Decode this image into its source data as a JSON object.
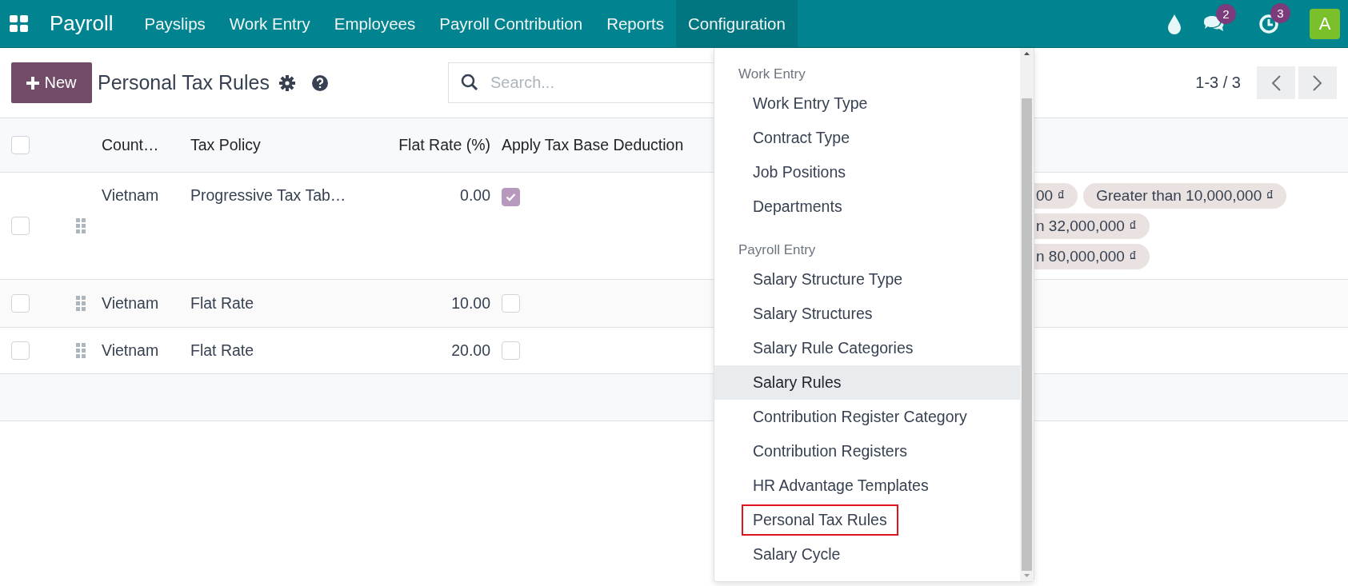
{
  "navbar": {
    "app": "Payroll",
    "menu": [
      {
        "label": "Payslips",
        "selected": false
      },
      {
        "label": "Work Entry",
        "selected": false
      },
      {
        "label": "Employees",
        "selected": false
      },
      {
        "label": "Payroll Contribution",
        "selected": false
      },
      {
        "label": "Reports",
        "selected": false
      },
      {
        "label": "Configuration",
        "selected": true
      }
    ],
    "chat_badge": "2",
    "activity_badge": "3",
    "avatar": "A"
  },
  "control_panel": {
    "new_button": "New",
    "title": "Personal Tax Rules",
    "search": {
      "placeholder": "Search..."
    },
    "pager": "1-3 / 3"
  },
  "table": {
    "columns": [
      "Count…",
      "Tax Policy",
      "Flat Rate (%)",
      "Apply Tax Base Deduction"
    ],
    "header_checked": false,
    "rows": [
      {
        "checked": false,
        "country": "Vietnam",
        "tax_policy": "Progressive Tax Tab…",
        "flat_rate": "0.00",
        "apply_deduction": true,
        "tags": [
          [
            "00 ₫",
            "Greater than 10,000,000 ₫"
          ],
          [
            "n 32,000,000 ₫"
          ],
          [
            "n 80,000,000 ₫"
          ]
        ]
      },
      {
        "checked": false,
        "country": "Vietnam",
        "tax_policy": "Flat Rate",
        "flat_rate": "10.00",
        "apply_deduction": false
      },
      {
        "checked": false,
        "country": "Vietnam",
        "tax_policy": "Flat Rate",
        "flat_rate": "20.00",
        "apply_deduction": false
      }
    ]
  },
  "dropdown": {
    "sections": [
      {
        "title": "Work Entry",
        "items": [
          {
            "label": "Work Entry Type",
            "highlighted": false,
            "outlined": false
          },
          {
            "label": "Contract Type",
            "highlighted": false,
            "outlined": false
          },
          {
            "label": "Job Positions",
            "highlighted": false,
            "outlined": false
          },
          {
            "label": "Departments",
            "highlighted": false,
            "outlined": false
          }
        ]
      },
      {
        "title": "Payroll Entry",
        "items": [
          {
            "label": "Salary Structure Type",
            "highlighted": false,
            "outlined": false
          },
          {
            "label": "Salary Structures",
            "highlighted": false,
            "outlined": false
          },
          {
            "label": "Salary Rule Categories",
            "highlighted": false,
            "outlined": false
          },
          {
            "label": "Salary Rules",
            "highlighted": true,
            "outlined": false
          },
          {
            "label": "Contribution Register Category",
            "highlighted": false,
            "outlined": false
          },
          {
            "label": "Contribution Registers",
            "highlighted": false,
            "outlined": false
          },
          {
            "label": "HR Advantage Templates",
            "highlighted": false,
            "outlined": false
          },
          {
            "label": "Personal Tax Rules",
            "highlighted": false,
            "outlined": true
          },
          {
            "label": "Salary Cycle",
            "highlighted": false,
            "outlined": false
          }
        ]
      }
    ]
  }
}
